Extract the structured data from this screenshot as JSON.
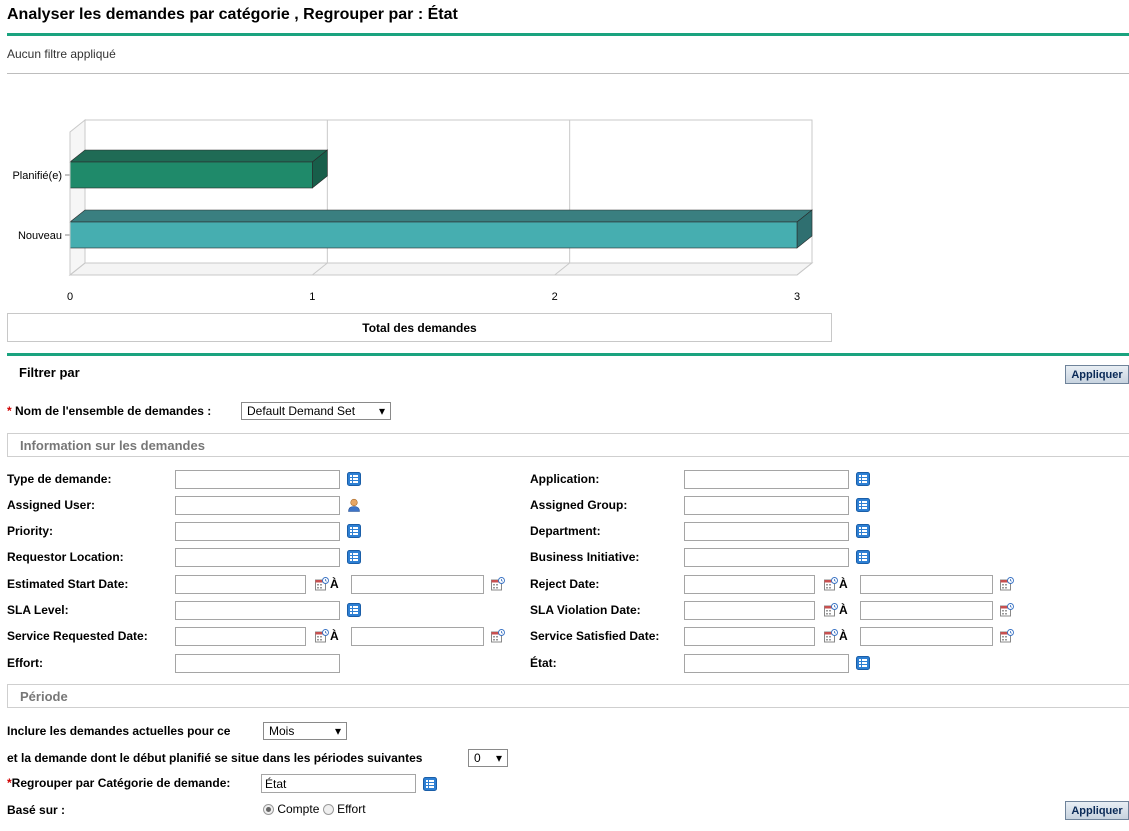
{
  "page": {
    "title": "Analyser les demandes par catégorie , Regrouper par : État",
    "subtitle": "Aucun filtre appliqué"
  },
  "chart_data": {
    "type": "bar",
    "orientation": "horizontal",
    "categories": [
      "Planifié(e)",
      "Nouveau"
    ],
    "values": [
      1,
      3
    ],
    "colors": [
      "#1f8a6a",
      "#46aeb0"
    ],
    "xlabel": "Total des demandes",
    "xticks": [
      "0",
      "1",
      "2",
      "3"
    ],
    "xlim": [
      0,
      3
    ],
    "grid": true,
    "style": "3d"
  },
  "filter": {
    "title": "Filtrer par",
    "apply_label": "Appliquer",
    "demand_set": {
      "label": "Nom de l'ensemble de demandes :",
      "value": "Default Demand Set"
    },
    "info_section": "Information sur les demandes",
    "left_fields": [
      {
        "label": "Type de demande:",
        "kind": "list"
      },
      {
        "label": "Assigned User:",
        "kind": "user"
      },
      {
        "label": "Priority:",
        "kind": "list"
      },
      {
        "label": "Requestor Location:",
        "kind": "list"
      },
      {
        "label": "Estimated Start Date:",
        "kind": "daterange",
        "to": "À"
      },
      {
        "label": "SLA Level:",
        "kind": "list"
      },
      {
        "label": "Service Requested Date:",
        "kind": "daterange",
        "to": "À"
      },
      {
        "label": "Effort:",
        "kind": "text"
      }
    ],
    "right_fields": [
      {
        "label": "Application:",
        "kind": "list"
      },
      {
        "label": "Assigned Group:",
        "kind": "list"
      },
      {
        "label": "Department:",
        "kind": "list"
      },
      {
        "label": "Business Initiative:",
        "kind": "list"
      },
      {
        "label": "Reject Date:",
        "kind": "daterange",
        "to": "À"
      },
      {
        "label": "SLA Violation Date:",
        "kind": "daterange",
        "to": "À"
      },
      {
        "label": "Service Satisfied Date:",
        "kind": "daterange",
        "to": "À"
      },
      {
        "label": "État:",
        "kind": "list"
      }
    ],
    "period_section": "Période",
    "include_label": "Inclure les demandes actuelles pour ce",
    "include_value": "Mois",
    "periods_label": "et la demande dont le début planifié se situe dans les périodes suivantes",
    "periods_value": "0",
    "groupby_label": "Regrouper par Catégorie de demande:",
    "groupby_value": "État",
    "based_label": "Basé sur :",
    "based_options": [
      "Compte",
      "Effort"
    ],
    "based_selected": "Compte"
  }
}
